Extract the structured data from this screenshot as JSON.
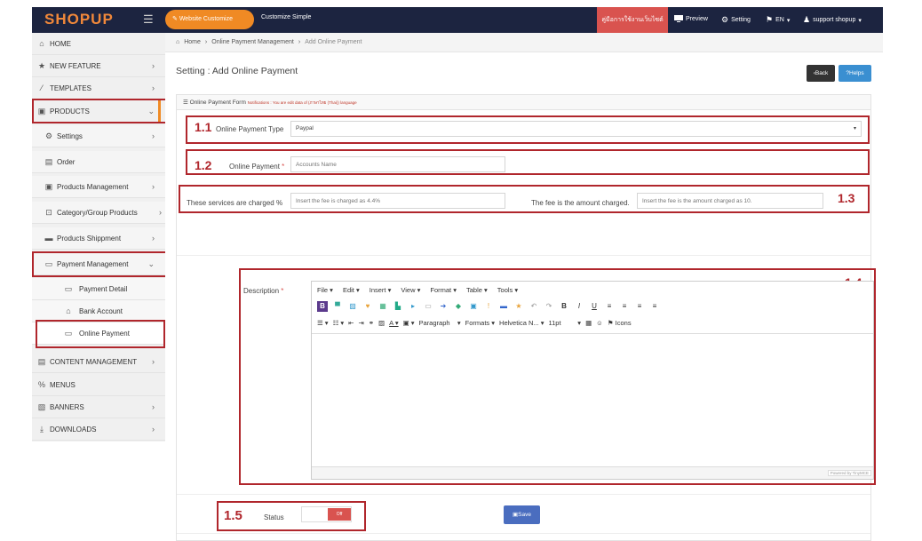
{
  "topbar": {
    "logo": "SHOPUP",
    "website_customize": "Website Customize",
    "customize_simple": "Customize Simple",
    "manual": "คู่มือการใช้งานเว็บไซต์",
    "preview": "Preview",
    "setting": "Setting",
    "language": "EN",
    "user": "support shopup"
  },
  "sidebar": {
    "items": [
      {
        "label": "HOME",
        "icon": "home-icon"
      },
      {
        "label": "NEW FEATURE",
        "icon": "star-icon"
      },
      {
        "label": "TEMPLATES",
        "icon": "magic-icon"
      },
      {
        "label": "PRODUCTS",
        "icon": "gift-icon"
      },
      {
        "label": "Settings",
        "icon": "gear-icon"
      },
      {
        "label": "Order",
        "icon": "file-icon"
      },
      {
        "label": "Products Management",
        "icon": "gift-icon"
      },
      {
        "label": "Category/Group Products",
        "icon": "category-icon"
      },
      {
        "label": "Products Shippment",
        "icon": "truck-icon"
      },
      {
        "label": "Payment Management",
        "icon": "card-icon"
      },
      {
        "label": "Payment Detail",
        "icon": "card-icon"
      },
      {
        "label": "Bank Account",
        "icon": "bank-icon"
      },
      {
        "label": "Online Payment",
        "icon": "money-icon"
      },
      {
        "label": "CONTENT MANAGEMENT",
        "icon": "file-icon"
      },
      {
        "label": "MENUS",
        "icon": "menu-icon"
      },
      {
        "label": "BANNERS",
        "icon": "image-icon"
      },
      {
        "label": "DOWNLOADS",
        "icon": "download-icon"
      }
    ]
  },
  "breadcrumb": {
    "home": "Home",
    "level1": "Online Payment Management",
    "current": "Add Online Payment"
  },
  "page": {
    "title": "Setting : Add Online Payment",
    "back": "Back",
    "helps": "Helps"
  },
  "form": {
    "header": "Online Payment Form",
    "notification": "Notifications : You are edit data of (ภาษาไทย (Thai)) language",
    "type_label": "Online Payment Type",
    "type_value": "Paypal",
    "payment_label": "Online Payment",
    "payment_placeholder": "Accounts Name",
    "fee_percent_label": "These services are charged %",
    "fee_percent_placeholder": "Insert the fee is charged as 4.4%",
    "fee_amount_label": "The fee is the amount charged.",
    "fee_amount_placeholder": "Insert the fee is the amount charged as 10.",
    "description_label": "Description",
    "status_label": "Status",
    "status_value": "Off",
    "save": "Save"
  },
  "editor": {
    "menus": [
      "File",
      "Edit",
      "Insert",
      "View",
      "Format",
      "Table",
      "Tools"
    ],
    "paragraph": "Paragraph",
    "formats": "Formats",
    "font": "Helvetica N...",
    "size": "11pt",
    "icons": "Icons",
    "powered": "Powered by TinyMCE"
  },
  "annotations": {
    "a1": "1.1",
    "a2": "1.2",
    "a3": "1.3",
    "a4": "1.4",
    "a5": "1.5"
  },
  "colors": {
    "accent": "#f08a24",
    "topbar": "#1c2440",
    "highlight": "#b0262c",
    "save": "#4a6dbf"
  }
}
